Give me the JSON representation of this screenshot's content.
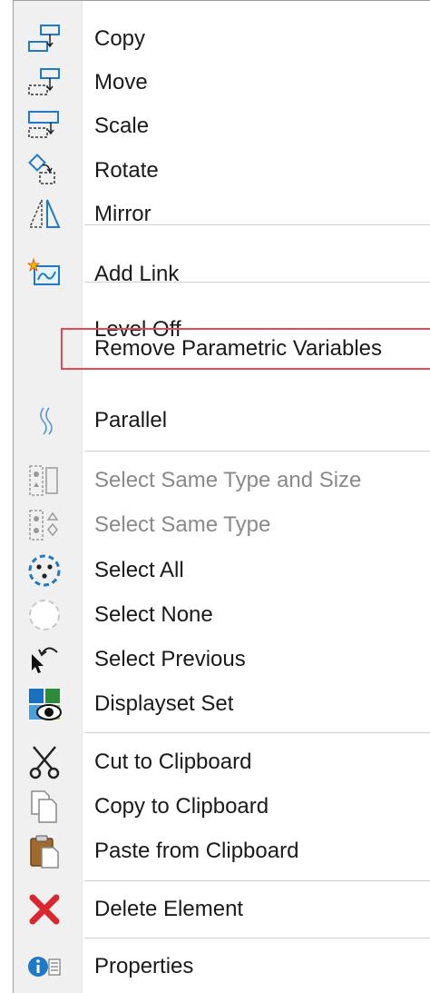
{
  "menu": {
    "items": [
      {
        "label": "Copy",
        "icon": "copy-icon",
        "enabled": true
      },
      {
        "label": "Move",
        "icon": "move-icon",
        "enabled": true
      },
      {
        "label": "Scale",
        "icon": "scale-icon",
        "enabled": true
      },
      {
        "label": "Rotate",
        "icon": "rotate-icon",
        "enabled": true
      },
      {
        "label": "Mirror",
        "icon": "mirror-icon",
        "enabled": true
      },
      {
        "label": "Add Link",
        "icon": "add-link-icon",
        "enabled": true
      },
      {
        "label": "Level Off",
        "icon": "",
        "enabled": true
      },
      {
        "label": "Remove Parametric Variables",
        "icon": "",
        "enabled": true,
        "highlighted": true
      },
      {
        "label": "Parallel",
        "icon": "parallel-icon",
        "enabled": true
      },
      {
        "label": "Select Same Type and Size",
        "icon": "select-same-type-size-icon",
        "enabled": false
      },
      {
        "label": "Select Same Type",
        "icon": "select-same-type-icon",
        "enabled": false
      },
      {
        "label": "Select All",
        "icon": "select-all-icon",
        "enabled": true
      },
      {
        "label": "Select None",
        "icon": "select-none-icon",
        "enabled": true
      },
      {
        "label": "Select Previous",
        "icon": "select-previous-icon",
        "enabled": true
      },
      {
        "label": "Displayset Set",
        "icon": "displayset-icon",
        "enabled": true
      },
      {
        "label": "Cut to Clipboard",
        "icon": "scissors-icon",
        "enabled": true
      },
      {
        "label": "Copy to Clipboard",
        "icon": "copy-pages-icon",
        "enabled": true
      },
      {
        "label": "Paste from Clipboard",
        "icon": "clipboard-paste-icon",
        "enabled": true
      },
      {
        "label": "Delete Element",
        "icon": "delete-x-icon",
        "enabled": true
      },
      {
        "label": "Properties",
        "icon": "properties-info-icon",
        "enabled": true
      }
    ]
  },
  "colors": {
    "icon_blue": "#1e79c8",
    "delete_red": "#d9262f",
    "highlight_red": "#e24a55",
    "disabled_text": "#8a8a8a"
  }
}
